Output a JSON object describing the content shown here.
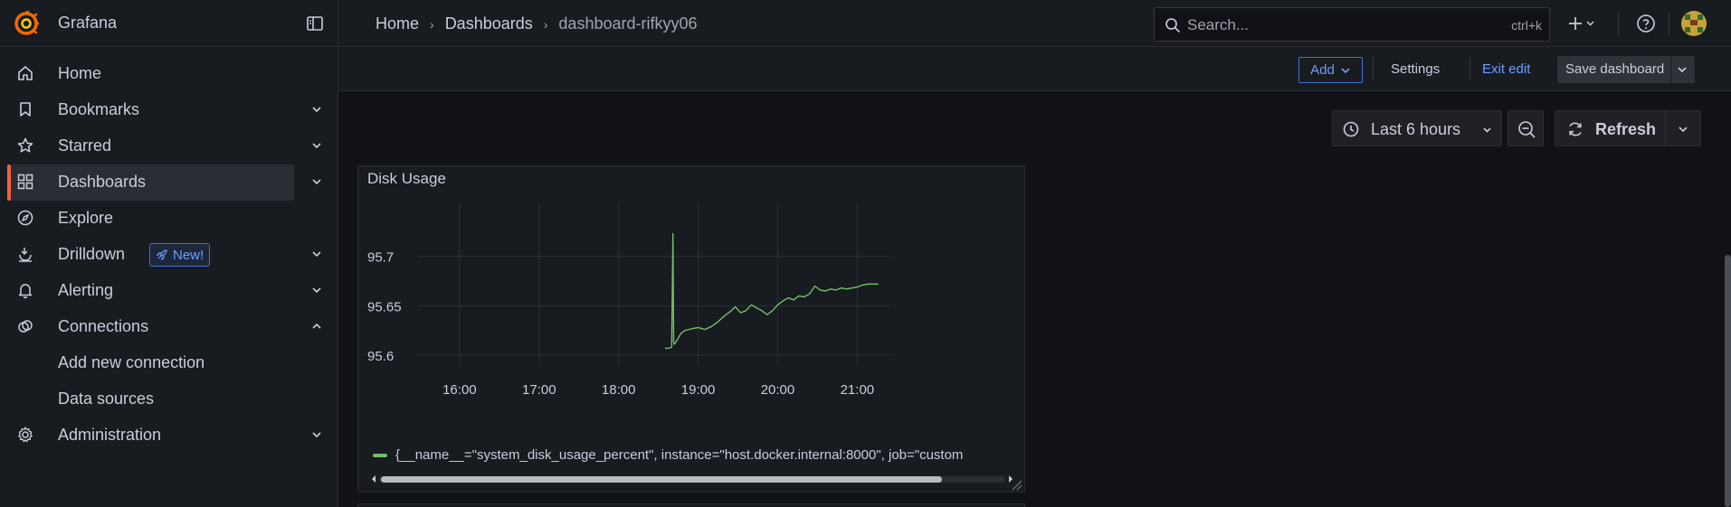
{
  "brand": {
    "name": "Grafana"
  },
  "sidebar": {
    "items": [
      {
        "label": "Home",
        "icon": "home-icon",
        "chevron": ""
      },
      {
        "label": "Bookmarks",
        "icon": "bookmark-icon",
        "chevron": "down"
      },
      {
        "label": "Starred",
        "icon": "star-icon",
        "chevron": "down"
      },
      {
        "label": "Dashboards",
        "icon": "dashboards-icon",
        "chevron": "down",
        "active": true
      },
      {
        "label": "Explore",
        "icon": "compass-icon",
        "chevron": ""
      },
      {
        "label": "Drilldown",
        "icon": "drilldown-icon",
        "chevron": "down",
        "badge": "New!"
      },
      {
        "label": "Alerting",
        "icon": "bell-icon",
        "chevron": "down"
      },
      {
        "label": "Connections",
        "icon": "connections-icon",
        "chevron": "up"
      },
      {
        "label": "Add new connection",
        "sub": true
      },
      {
        "label": "Data sources",
        "sub": true
      },
      {
        "label": "Administration",
        "icon": "cog-icon",
        "chevron": "down"
      }
    ]
  },
  "breadcrumb": [
    "Home",
    "Dashboards",
    "dashboard-rifkyy06"
  ],
  "search": {
    "placeholder": "Search...",
    "shortcut": "ctrl+k"
  },
  "toolbar": {
    "add_label": "Add",
    "settings_label": "Settings",
    "exit_edit_label": "Exit edit",
    "save_label": "Save dashboard"
  },
  "time": {
    "range_label": "Last 6 hours",
    "refresh_label": "Refresh"
  },
  "panel": {
    "title": "Disk Usage",
    "legend": "{__name__=\"system_disk_usage_percent\", instance=\"host.docker.internal:8000\", job=\"custom"
  },
  "colors": {
    "accent": "#f55f3e",
    "series": "#73bf69",
    "link": "#6e9fff"
  },
  "chart_data": {
    "type": "line",
    "title": "Disk Usage",
    "xlabel": "",
    "ylabel": "",
    "x_ticks": [
      "16:00",
      "17:00",
      "18:00",
      "19:00",
      "20:00",
      "21:00"
    ],
    "y_ticks": [
      "95.6",
      "95.65",
      "95.7"
    ],
    "ylim": [
      95.59,
      95.75
    ],
    "grid": true,
    "legend_position": "bottom",
    "series": [
      {
        "name": "{__name__=\"system_disk_usage_percent\", instance=\"host.docker.internal:8000\", job=\"custom",
        "x": [
          "18:35",
          "18:37",
          "18:40",
          "18:41",
          "18:41.5",
          "18:42",
          "18:44",
          "18:47",
          "18:50",
          "18:53",
          "18:56",
          "19:00",
          "19:05",
          "19:10",
          "19:15",
          "19:20",
          "19:25",
          "19:28",
          "19:32",
          "19:36",
          "19:40",
          "19:44",
          "19:48",
          "19:52",
          "19:56",
          "20:00",
          "20:04",
          "20:08",
          "20:12",
          "20:16",
          "20:20",
          "20:24",
          "20:28",
          "20:32",
          "20:36",
          "20:40",
          "20:44",
          "20:48",
          "20:52",
          "20:56",
          "21:00",
          "21:04",
          "21:08",
          "21:12",
          "21:16"
        ],
        "y": [
          95.607,
          95.607,
          95.608,
          95.723,
          95.613,
          95.611,
          95.615,
          95.622,
          95.625,
          95.626,
          95.627,
          95.628,
          95.626,
          95.629,
          95.634,
          95.64,
          95.645,
          95.649,
          95.643,
          95.645,
          95.651,
          95.648,
          95.645,
          95.641,
          95.645,
          95.651,
          95.655,
          95.658,
          95.656,
          95.66,
          95.659,
          95.662,
          95.67,
          95.666,
          95.665,
          95.667,
          95.666,
          95.668,
          95.667,
          95.668,
          95.669,
          95.671,
          95.672,
          95.672,
          95.672
        ]
      }
    ]
  }
}
